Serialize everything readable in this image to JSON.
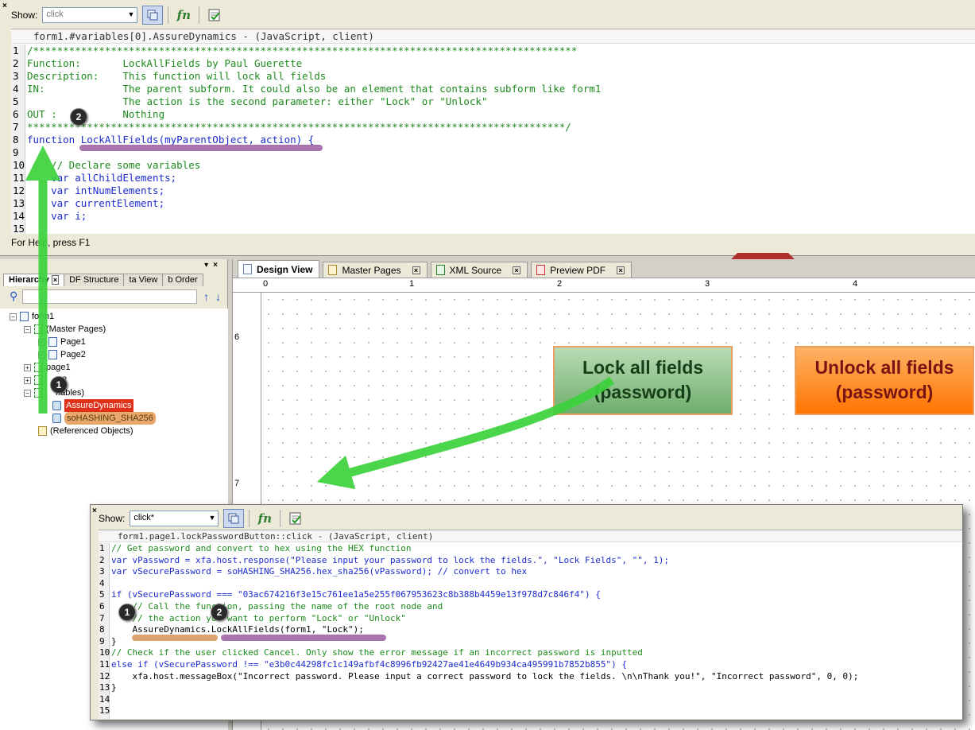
{
  "top_editor": {
    "show_label": "Show:",
    "show_value": "click",
    "header": "form1.#variables[0].AssureDynamics - (JavaScript, client)",
    "lines": [
      {
        "n": "1",
        "t": "/*******************************************************************************************"
      },
      {
        "n": "2",
        "t": "Function:       LockAllFields by Paul Guerette"
      },
      {
        "n": "3",
        "t": "Description:    This function will lock all fields"
      },
      {
        "n": "4",
        "t": "IN:             The parent subform. It could also be an element that contains subform like form1"
      },
      {
        "n": "5",
        "t": "                The action is the second parameter: either \"Lock\" or \"Unlock\""
      },
      {
        "n": "6",
        "t": "OUT :           Nothing"
      },
      {
        "n": "7",
        "t": "******************************************************************************************/"
      },
      {
        "n": "8",
        "t": "function LockAllFields(myParentObject, action) {"
      },
      {
        "n": "9",
        "t": ""
      },
      {
        "n": "10",
        "t": "    // Declare some variables"
      },
      {
        "n": "11",
        "t": "    var allChildElements;"
      },
      {
        "n": "12",
        "t": "    var intNumElements;"
      },
      {
        "n": "13",
        "t": "    var currentElement;"
      },
      {
        "n": "14",
        "t": "    var i;"
      },
      {
        "n": "15",
        "t": ""
      }
    ],
    "status": "For Help, press F1"
  },
  "hierarchy": {
    "tabs": [
      "Hierarchy",
      "PDF Structure",
      "Data View",
      "Tab Order"
    ],
    "tab_visible_text": [
      "Hierarchy",
      "DF Structure",
      "ta View",
      "b Order"
    ],
    "tree": [
      {
        "label": "form1",
        "depth": 0,
        "icon": "form-icon"
      },
      {
        "label": "(Master Pages)",
        "depth": 1,
        "icon": "folder-icon"
      },
      {
        "label": "Page1",
        "depth": 2,
        "icon": "page-icon"
      },
      {
        "label": "Page2",
        "depth": 2,
        "icon": "page-icon"
      },
      {
        "label": "page1",
        "depth": 1,
        "icon": "subform-icon"
      },
      {
        "label": "e2",
        "depth": 1,
        "icon": "subform-icon"
      },
      {
        "label": "riables)",
        "depth": 1,
        "icon": "variables-icon"
      },
      {
        "label": "AssureDynamics",
        "depth": 2,
        "icon": "script-object-icon",
        "highlight": "red"
      },
      {
        "label": "soHASHING_SHA256",
        "depth": 2,
        "icon": "script-object-icon",
        "highlight": "orange"
      },
      {
        "label": "(Referenced Objects)",
        "depth": 1,
        "icon": "referenced-objects-icon"
      }
    ]
  },
  "design": {
    "tabs": [
      {
        "label": "Design View",
        "icon": "page-icon",
        "active": true
      },
      {
        "label": "Master Pages",
        "icon": "master-page-icon",
        "active": false
      },
      {
        "label": "XML Source",
        "icon": "xml-icon",
        "active": false
      },
      {
        "label": "Preview PDF",
        "icon": "pdf-icon",
        "active": false
      }
    ],
    "ruler_top": [
      "0",
      "1",
      "2",
      "3",
      "4"
    ],
    "ruler_left": [
      "6",
      "7"
    ],
    "lock_button": {
      "line1": "Lock all fields",
      "line2": "(password)",
      "color": "#6fae6d"
    },
    "unlock_button": {
      "line1": "Unlock all fields",
      "line2": "(password)",
      "color": "#ff7400"
    }
  },
  "bottom_editor": {
    "show_label": "Show:",
    "show_value": "click*",
    "header": "form1.page1.lockPasswordButton::click - (JavaScript, client)",
    "lines": [
      {
        "n": "1",
        "t": "// Get password and convert to hex using the HEX function"
      },
      {
        "n": "2",
        "t": "var vPassword = xfa.host.response(\"Please input your password to lock the fields.\", \"Lock Fields\", \"\", 1);"
      },
      {
        "n": "3",
        "t": "var vSecurePassword = soHASHING_SHA256.hex_sha256(vPassword); // convert to hex"
      },
      {
        "n": "4",
        "t": ""
      },
      {
        "n": "5",
        "t": "if (vSecurePassword === \"03ac674216f3e15c761ee1a5e255f067953623c8b388b4459e13f978d7c846f4\") {"
      },
      {
        "n": "6",
        "t": "    // Call the function, passing the name of the root node and"
      },
      {
        "n": "7",
        "t": "    // the action you want to perform \"Lock\" or \"Unlock\""
      },
      {
        "n": "8",
        "t": "    AssureDynamics.LockAllFields(form1, \"Lock\");"
      },
      {
        "n": "9",
        "t": "}"
      },
      {
        "n": "10",
        "t": "// Check if the user clicked Cancel. Only show the error message if an incorrect password is inputted"
      },
      {
        "n": "11",
        "t": "else if (vSecurePassword !== \"e3b0c44298fc1c149afbf4c8996fb92427ae41e4649b934ca495991b7852b855\") {"
      },
      {
        "n": "12",
        "t": "    xfa.host.messageBox(\"Incorrect password. Please input a correct password to lock the fields. \\n\\nThank you!\", \"Incorrect password\", 0, 0);"
      },
      {
        "n": "13",
        "t": "}"
      },
      {
        "n": "14",
        "t": ""
      },
      {
        "n": "15",
        "t": ""
      }
    ]
  },
  "annotations": {
    "badge1": "1",
    "badge2": "2",
    "arrow_color": "#3cd23c",
    "underline_orange": "#d89a60",
    "underline_purple": "#9a5aa0"
  }
}
